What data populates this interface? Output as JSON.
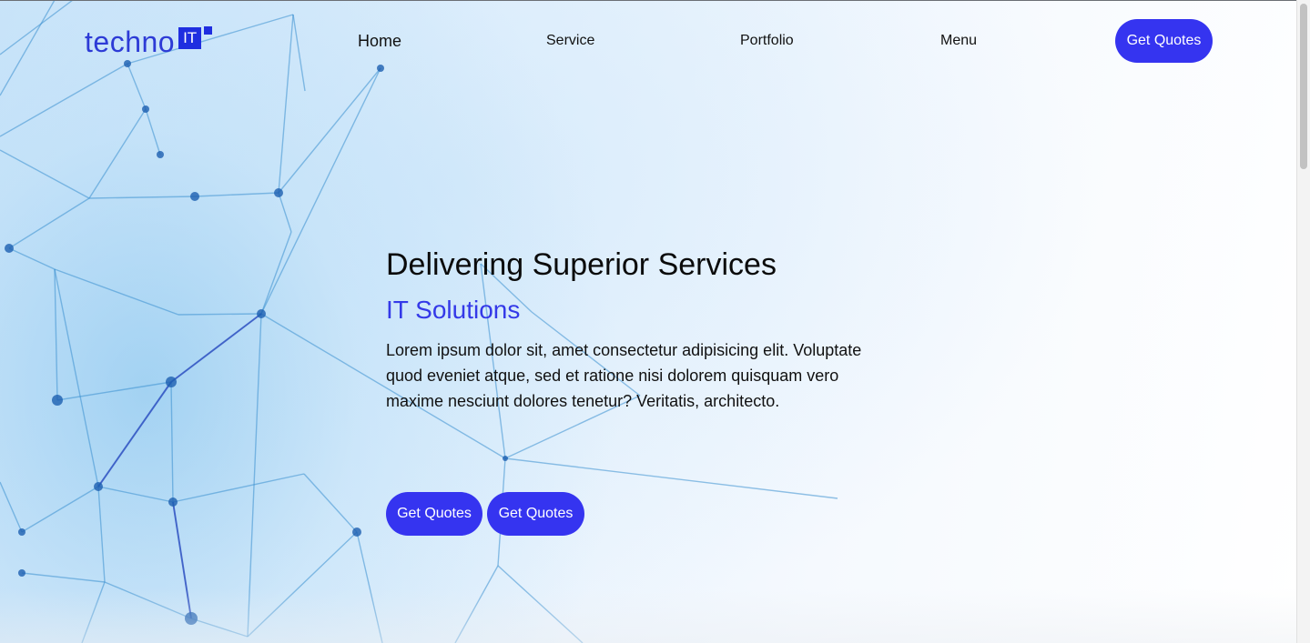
{
  "header": {
    "logo": {
      "text": "techno",
      "badge": "IT"
    },
    "nav": [
      {
        "label": "Home"
      },
      {
        "label": "Service"
      },
      {
        "label": "Portfolio"
      },
      {
        "label": "Menu"
      }
    ],
    "cta_label": "Get Quotes"
  },
  "hero": {
    "title": "Delivering Superior Services",
    "subtitle": "IT Solutions",
    "body": "Lorem ipsum dolor sit, amet consectetur adipisicing elit. Voluptate quod eveniet atque, sed et ratione nisi dolorem quisquam vero maxime nesciunt dolores tenetur? Veritatis, architecto.",
    "buttons": [
      {
        "label": "Get Quotes"
      },
      {
        "label": "Get Quotes"
      }
    ],
    "background_image": "network-mesh"
  },
  "colors": {
    "accent": "#3534f0",
    "logo": "#2d3bd6",
    "subtitle": "#3439e8"
  }
}
